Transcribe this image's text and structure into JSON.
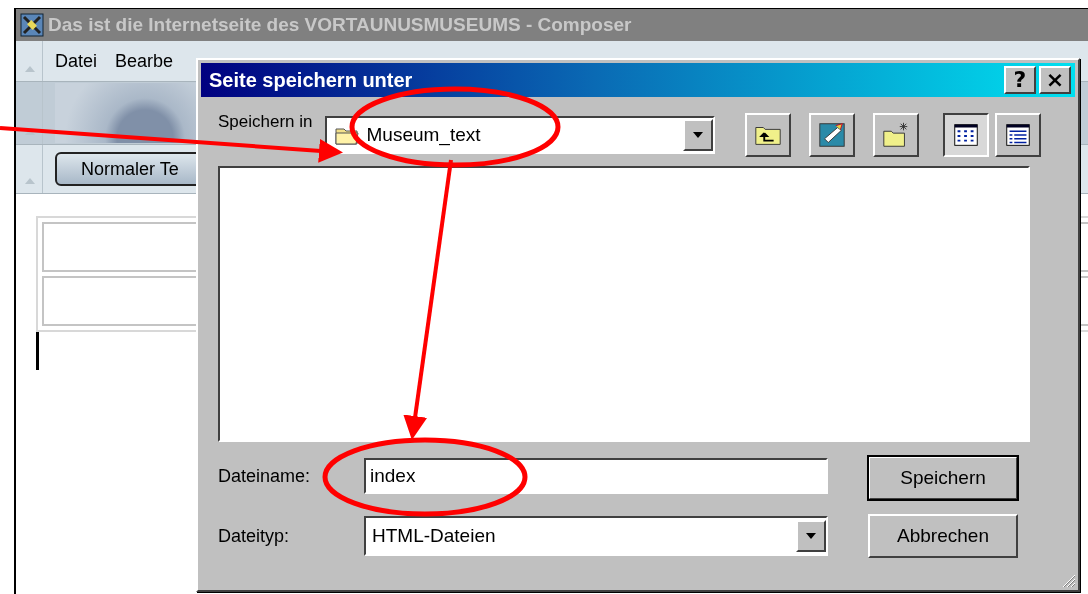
{
  "window": {
    "title": "Das ist die Internetseite des VORTAUNUSMUSEUMS - Composer",
    "active": false
  },
  "menu": [
    {
      "label": "Datei"
    },
    {
      "label": "Bearbe"
    }
  ],
  "format_bar": {
    "style_button": "Normaler Te"
  },
  "dialog": {
    "title": "Seite speichern unter",
    "help_button": "?",
    "close_button": "×",
    "location_label": "Speichern in",
    "location_value": "Museum_text",
    "toolbar": [
      {
        "kind": "up"
      },
      {
        "kind": "desktop"
      },
      {
        "kind": "new-folder"
      },
      {
        "kind": "list-view",
        "selected": true
      },
      {
        "kind": "details-view",
        "selected": false
      }
    ],
    "filename_label": "Dateiname:",
    "filename_value": "index",
    "filetype_label": "Dateityp:",
    "filetype_value": "HTML-Dateien",
    "buttons": [
      {
        "label": "Speichern",
        "default": true
      },
      {
        "label": "Abbrechen",
        "default": false
      }
    ]
  }
}
